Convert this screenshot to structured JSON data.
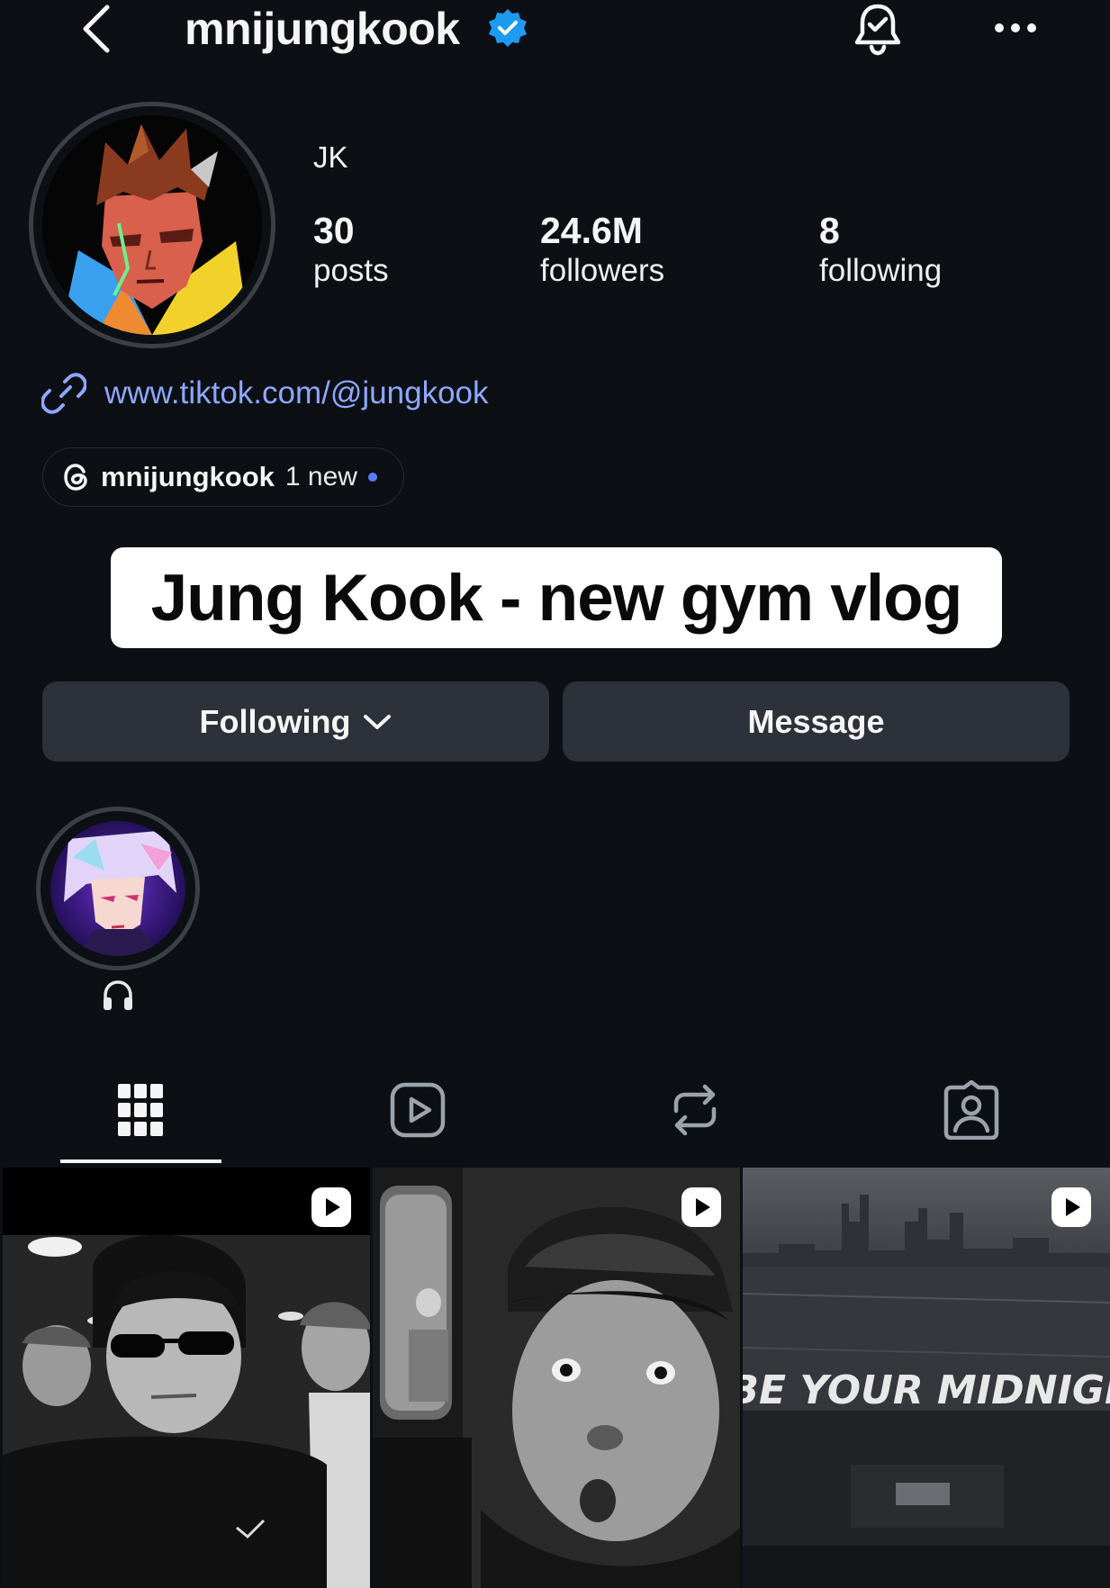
{
  "header": {
    "username": "mnijungkook",
    "verified_icon": "verified-badge-icon",
    "back_icon": "chevron-left-icon",
    "notify_icon": "bell-check-icon",
    "more_icon": "more-horizontal-icon"
  },
  "profile": {
    "display_name": "JK",
    "stats": {
      "posts": {
        "value": "30",
        "label": "posts"
      },
      "followers": {
        "value": "24.6M",
        "label": "followers"
      },
      "following": {
        "value": "8",
        "label": "following"
      }
    },
    "link": "www.tiktok.com/@jungkook",
    "threads": {
      "name": "mnijungkook",
      "badge": "1 new"
    }
  },
  "caption_overlay": "Jung Kook - new gym vlog",
  "actions": {
    "following_label": "Following",
    "message_label": "Message"
  },
  "highlight": {
    "label_icon": "headphones-icon"
  },
  "tabs": [
    {
      "name": "grid",
      "icon": "grid-icon",
      "active": true
    },
    {
      "name": "reels",
      "icon": "reels-icon",
      "active": false
    },
    {
      "name": "reposts",
      "icon": "repost-icon",
      "active": false
    },
    {
      "name": "tagged",
      "icon": "tagged-person-icon",
      "active": false
    }
  ],
  "posts": [
    {
      "type": "reel",
      "icon": "reel-play-icon"
    },
    {
      "type": "reel",
      "icon": "reel-play-icon"
    },
    {
      "type": "reel",
      "icon": "reel-play-icon",
      "overlay_text": "T BE YOUR MIDNIGHT"
    }
  ],
  "colors": {
    "background": "#0c1014",
    "button": "#2c313a",
    "link": "#8ea7ff",
    "verified": "#1d9bf0",
    "threads_dot": "#5b7cff"
  }
}
